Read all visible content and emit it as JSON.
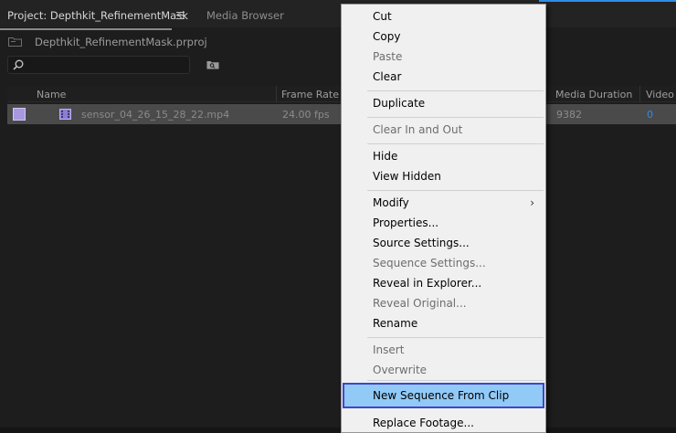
{
  "tabs": {
    "project": "Project: Depthkit_RefinementMask",
    "media_browser": "Media Browser"
  },
  "project_file": "Depthkit_RefinementMask.prproj",
  "columns": {
    "name": "Name",
    "frame_rate": "Frame Rate",
    "media_duration": "Media Duration",
    "video": "Video"
  },
  "row": {
    "name": "sensor_04_26_15_28_22.mp4",
    "frame_rate": "24.00 fps",
    "media_duration": "9382",
    "video": "0",
    "label_color": "#a998e0"
  },
  "menu": {
    "cut": "Cut",
    "copy": "Copy",
    "paste": "Paste",
    "clear": "Clear",
    "duplicate": "Duplicate",
    "clear_in_out": "Clear In and Out",
    "hide": "Hide",
    "view_hidden": "View Hidden",
    "modify": "Modify",
    "properties": "Properties...",
    "source_settings": "Source Settings...",
    "sequence_settings": "Sequence Settings...",
    "reveal_explorer": "Reveal in Explorer...",
    "reveal_original": "Reveal Original...",
    "rename": "Rename",
    "insert": "Insert",
    "overwrite": "Overwrite",
    "new_sequence": "New Sequence From Clip",
    "replace_footage": "Replace Footage..."
  },
  "colors": {
    "accent": "#2d8ceb",
    "highlight": "#91c9f7",
    "highlight_border": "#3f47c9"
  }
}
